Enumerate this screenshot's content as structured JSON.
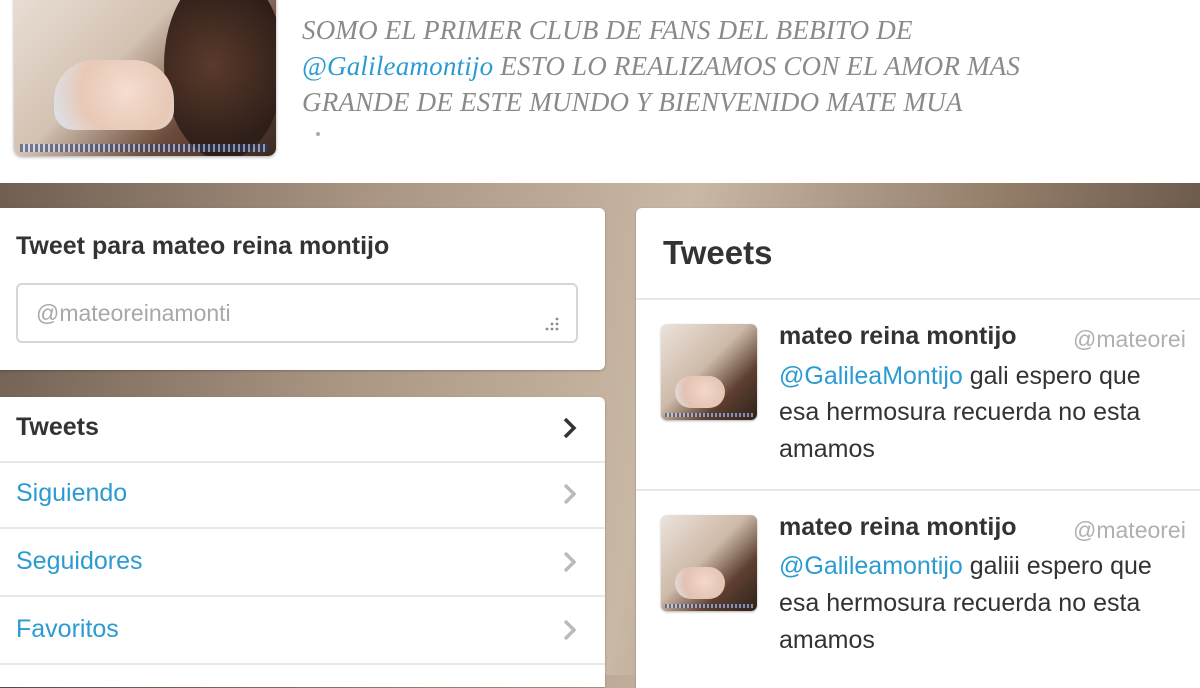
{
  "profile": {
    "bio_line1": "SOMO EL PRIMER CLUB DE FANS DEL BEBITO DE",
    "bio_mention": "@Galileamontijo",
    "bio_line2_rest": " ESTO LO REALIZAMOS CON EL AMOR MAS",
    "bio_line3": "GRANDE DE ESTE MUNDO Y BIENVENIDO MATE MUA"
  },
  "tweet_box": {
    "title": "Tweet para mateo reina montijo",
    "placeholder": "@mateoreinamonti"
  },
  "nav": {
    "items": [
      {
        "label": "Tweets",
        "active": true
      },
      {
        "label": "Siguiendo",
        "active": false
      },
      {
        "label": "Seguidores",
        "active": false
      },
      {
        "label": "Favoritos",
        "active": false
      }
    ]
  },
  "timeline": {
    "title": "Tweets",
    "tweets": [
      {
        "name": "mateo reina montijo",
        "handle": "@mateorei",
        "mention": "@GalileaMontijo",
        "line1_rest": " gali espero que",
        "line2": "esa hermosura recuerda no esta",
        "line3": "amamos"
      },
      {
        "name": "mateo reina montijo",
        "handle": "@mateorei",
        "mention": "@Galileamontijo",
        "line1_rest": " galiii espero que",
        "line2": "esa hermosura recuerda no esta",
        "line3": "amamos"
      }
    ]
  },
  "colors": {
    "link": "#2b9bd2",
    "text": "#333333",
    "muted": "#b0b0b0"
  }
}
